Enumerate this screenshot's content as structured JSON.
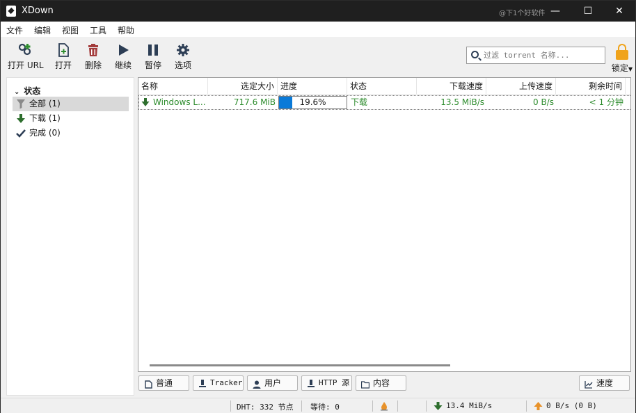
{
  "window": {
    "title": "XDown",
    "watermark": "@下1个好软件",
    "minimize": "—",
    "maximize": "☐",
    "close": "✕"
  },
  "menu": [
    "文件",
    "编辑",
    "视图",
    "工具",
    "帮助"
  ],
  "toolbar": {
    "open_url": "打开 URL",
    "open": "打开",
    "delete": "删除",
    "resume": "继续",
    "pause": "暂停",
    "options": "选项",
    "lock": "锁定"
  },
  "search": {
    "placeholder": "过滤 torrent 名称..."
  },
  "sidebar": {
    "header": "状态",
    "items": [
      {
        "label": "全部 (1)",
        "icon": "filter-icon"
      },
      {
        "label": "下载 (1)",
        "icon": "arrow-down-icon"
      },
      {
        "label": "完成 (0)",
        "icon": "checkmark-icon"
      }
    ]
  },
  "table": {
    "columns": [
      "名称",
      "选定大小",
      "进度",
      "状态",
      "下载速度",
      "上传速度",
      "剩余时间"
    ],
    "rows": [
      {
        "name": "Windows L...",
        "size": "717.6 MiB",
        "progress": 0.196,
        "progress_text": "19.6%",
        "status": "下载",
        "down_speed": "13.5 MiB/s",
        "up_speed": "0 B/s",
        "eta": "< 1 分钟"
      }
    ]
  },
  "tabs": [
    "普通",
    "Tracker",
    "用户",
    "HTTP 源",
    "内容",
    "速度"
  ],
  "statusbar": {
    "dht": "DHT: 332 节点",
    "waiting": "等待: 0",
    "download": "13.4 MiB/s",
    "upload": "0 B/s (0 B)"
  },
  "colors": {
    "accent": "#0a7ad8",
    "downloading": "#2d8c2d",
    "lock": "#f0a31a",
    "delete": "#a33b3b"
  }
}
